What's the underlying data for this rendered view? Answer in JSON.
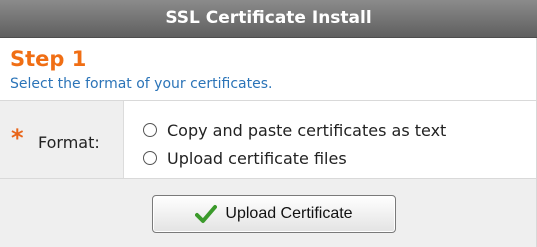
{
  "dialog": {
    "title": "SSL Certificate Install"
  },
  "step": {
    "title": "Step 1",
    "subtitle": "Select the format of your certificates."
  },
  "form": {
    "required_marker": "*",
    "format_label": "Format:",
    "options": [
      {
        "label": "Copy and paste certificates as text",
        "selected": false
      },
      {
        "label": "Upload certificate files",
        "selected": false
      }
    ]
  },
  "actions": {
    "upload_label": "Upload Certificate",
    "upload_icon": "check-icon"
  },
  "colors": {
    "titlebar": "#6f6f6f",
    "step_title": "#f06e14",
    "step_subtitle": "#2b74b8",
    "check": "#3b9a2b"
  }
}
